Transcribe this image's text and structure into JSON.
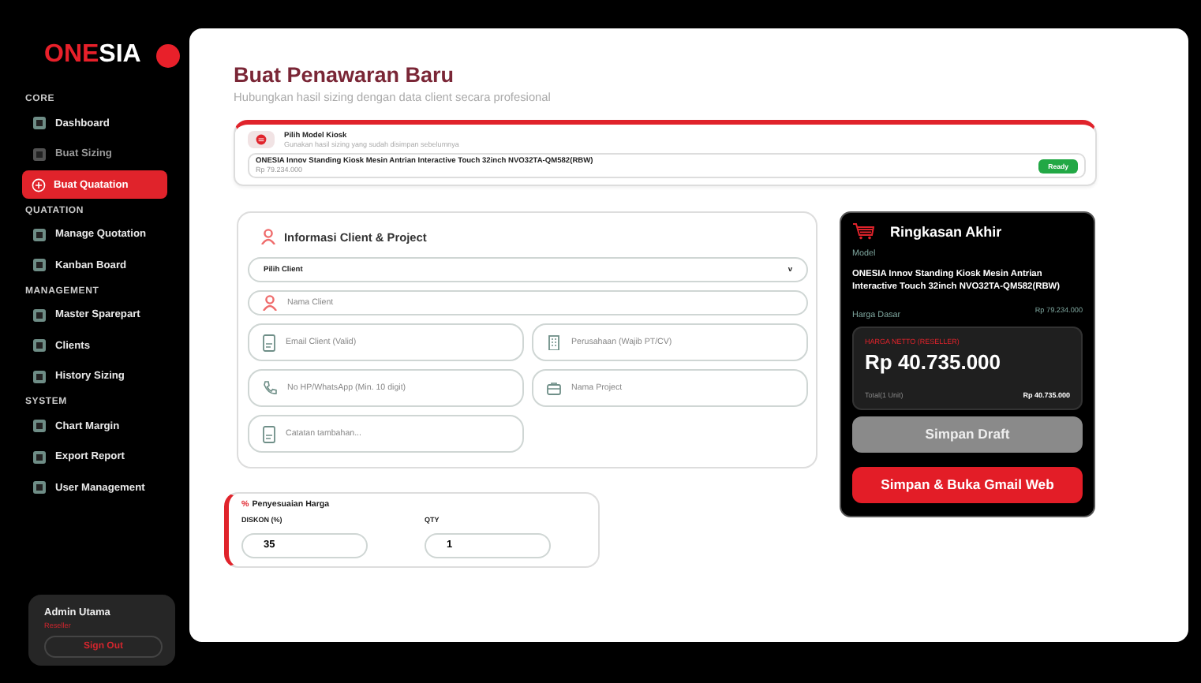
{
  "logo": {
    "accent": "ONE",
    "rest": "SIA"
  },
  "sidebar": {
    "sections": [
      {
        "title": "CORE",
        "items": [
          {
            "label": "Dashboard",
            "selected": false,
            "disabled": false
          },
          {
            "label": "Buat Sizing",
            "selected": false,
            "disabled": true
          },
          {
            "label": "Buat Quatation",
            "selected": true,
            "disabled": false
          }
        ]
      },
      {
        "title": "QUATATION",
        "items": [
          {
            "label": "Manage Quotation",
            "selected": false,
            "disabled": false
          },
          {
            "label": "Kanban Board",
            "selected": false,
            "disabled": false
          }
        ]
      },
      {
        "title": "MANAGEMENT",
        "items": [
          {
            "label": "Master Sparepart",
            "selected": false,
            "disabled": false
          },
          {
            "label": "Clients",
            "selected": false,
            "disabled": false
          },
          {
            "label": "History Sizing",
            "selected": false,
            "disabled": false
          }
        ]
      },
      {
        "title": "SYSTEM",
        "items": [
          {
            "label": "Chart Margin",
            "selected": false,
            "disabled": false
          },
          {
            "label": "Export Report",
            "selected": false,
            "disabled": false
          },
          {
            "label": "User Management",
            "selected": false,
            "disabled": false
          }
        ]
      }
    ],
    "user": {
      "name": "Admin Utama",
      "role": "Reseller",
      "button": "Sign Out"
    }
  },
  "header": {
    "title": "Buat Penawaran Baru",
    "subtitle": "Hubungkan hasil sizing dengan data client secara profesional"
  },
  "model_picker": {
    "title": "Pilih Model Kiosk",
    "hint": "Gunakan hasil sizing yang sudah disimpan sebelumnya",
    "model": "ONESIA Innov Standing Kiosk Mesin Antrian Interactive Touch 32inch NVO32TA-QM582(RBW)",
    "price": "Rp 79.234.000",
    "status": "Ready"
  },
  "client_form": {
    "title": "Informasi Client & Project",
    "fields": [
      {
        "kind": "select",
        "value": "Pilih Client",
        "caret": "v"
      },
      {
        "kind": "input",
        "placeholder": "Nama Client"
      },
      {
        "kind": "input",
        "placeholder": "Email Client (Valid)"
      },
      {
        "kind": "input",
        "placeholder": "Perusahaan (Wajib PT/CV)"
      },
      {
        "kind": "input",
        "placeholder": "No HP/WhatsApp (Min. 10 digit)"
      },
      {
        "kind": "input",
        "placeholder": "Nama Project"
      },
      {
        "kind": "input",
        "placeholder": "Catatan tambahan..."
      }
    ]
  },
  "price_adjustment": {
    "icon": "%",
    "title": "Penyesuaian Harga",
    "fields": [
      {
        "label": "DISKON (%)",
        "value": "35"
      },
      {
        "label": "QTY",
        "value": "1"
      }
    ]
  },
  "summary": {
    "title": "Ringkasan Akhir",
    "model_label": "Model",
    "model": "ONESIA Innov Standing Kiosk Mesin Antrian Interactive Touch 32inch NVO32TA-QM582(RBW)",
    "base_label": "Harga Dasar",
    "base_price": "Rp 79.234.000",
    "net_label": "HARGA NETTO (RESELLER)",
    "net_price": "Rp 40.735.000",
    "total_label": "Total(1 Unit)",
    "total": "Rp 40.735.000",
    "buttons": [
      {
        "kind": "draft",
        "label": "Simpan Draft"
      },
      {
        "kind": "primary",
        "label": "Simpan & Buka Gmail Web"
      }
    ]
  }
}
